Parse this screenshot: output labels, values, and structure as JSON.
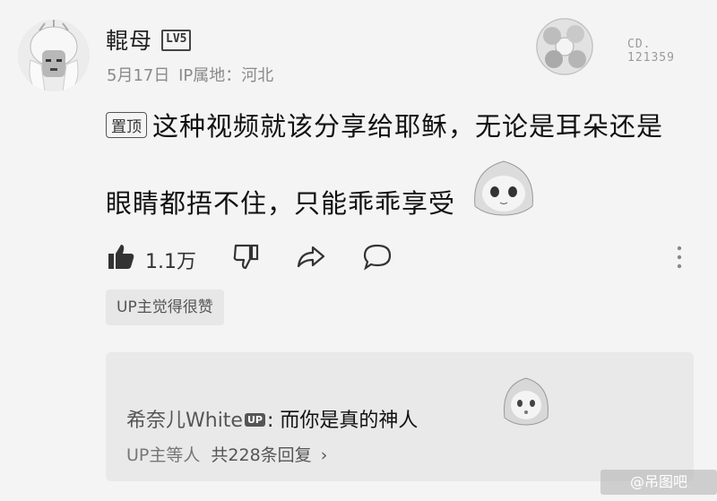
{
  "comment": {
    "username": "輥母",
    "level": "LV5",
    "date": "5月17日",
    "ip_location": "IP属地：河北",
    "pinned_label": "置顶",
    "text_line1": "这种视频就该分享给耶稣，无论是耳朵还是",
    "text_line2": "眼睛都捂不住，只能乖乖享受",
    "like_count": "1.1万",
    "up_liked_tag": "UP主觉得很赞"
  },
  "decoration": {
    "cd_label": "CD.",
    "cd_number": "121359"
  },
  "reply": {
    "name": "希奈儿White",
    "up_badge": "UP",
    "separator": ":",
    "text": "而你是真的神人",
    "footer_prefix": "UP主等人",
    "footer_count": "共228条回复",
    "chevron": "›"
  },
  "watermark": "@吊图吧",
  "icons": {
    "like": "thumb-up-icon",
    "dislike": "thumb-down-icon",
    "share": "share-icon",
    "comment": "comment-icon",
    "more": "more-vertical-icon"
  }
}
